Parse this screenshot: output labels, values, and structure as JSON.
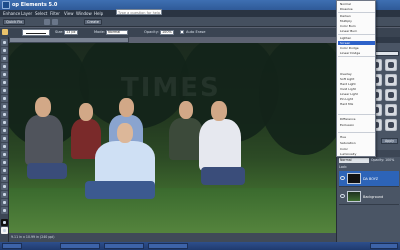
{
  "app": {
    "title": "op Elements 5.0"
  },
  "menu": {
    "items": [
      "Enhance",
      "Layer",
      "Select",
      "Filter",
      "View",
      "Window",
      "Help"
    ]
  },
  "help_search": {
    "placeholder": "Type a question for help"
  },
  "shortcuts": {
    "quick_fix": "Quick Fix",
    "create": "Create"
  },
  "options": {
    "size_label": "Size:",
    "size_value": "13 px",
    "mode_label": "Mode:",
    "mode_value": "Normal",
    "opacity_label": "Opacity:",
    "opacity_value": "100%",
    "auto_erase": "Auto Erase"
  },
  "document": {
    "tab_label": "",
    "status": "9.11 in x 10.99 in (240 ppi)",
    "watermark": "TIMES"
  },
  "blend_modes": {
    "groups": [
      [
        "Normal",
        "Dissolve"
      ],
      [
        "Darken",
        "Multiply",
        "Color Burn",
        "Linear Burn"
      ],
      [
        "Lighten",
        "Screen",
        "Color Dodge",
        "Linear Dodge"
      ],
      [
        "Overlay",
        "Soft Light",
        "Hard Light",
        "Vivid Light",
        "Linear Light",
        "Pin Light",
        "Hard Mix"
      ],
      [
        "Difference",
        "Exclusion"
      ],
      [
        "Hue",
        "Saturation",
        "Color",
        "Luminosity"
      ]
    ],
    "selected": "Screen"
  },
  "styles_panel": {
    "category": "Drop Shadows",
    "apply": "Apply"
  },
  "layers_panel": {
    "blend_value": "Normal",
    "opacity": "Opacity: 100%",
    "lock": "Lock:",
    "layers": [
      {
        "name": "DA BOYZ",
        "selected": true,
        "thumb": "mask"
      },
      {
        "name": "Background",
        "selected": false,
        "thumb": "photo"
      }
    ]
  },
  "taskbar": {
    "items": [
      "",
      "",
      "",
      "",
      ""
    ]
  },
  "colors": {
    "menu_highlight": "#2e62c9",
    "layer_selected": "#2d64b8"
  },
  "icons": [
    "app-logo-icon",
    "undo-icon",
    "redo-icon",
    "brush-icon",
    "eye-icon"
  ]
}
